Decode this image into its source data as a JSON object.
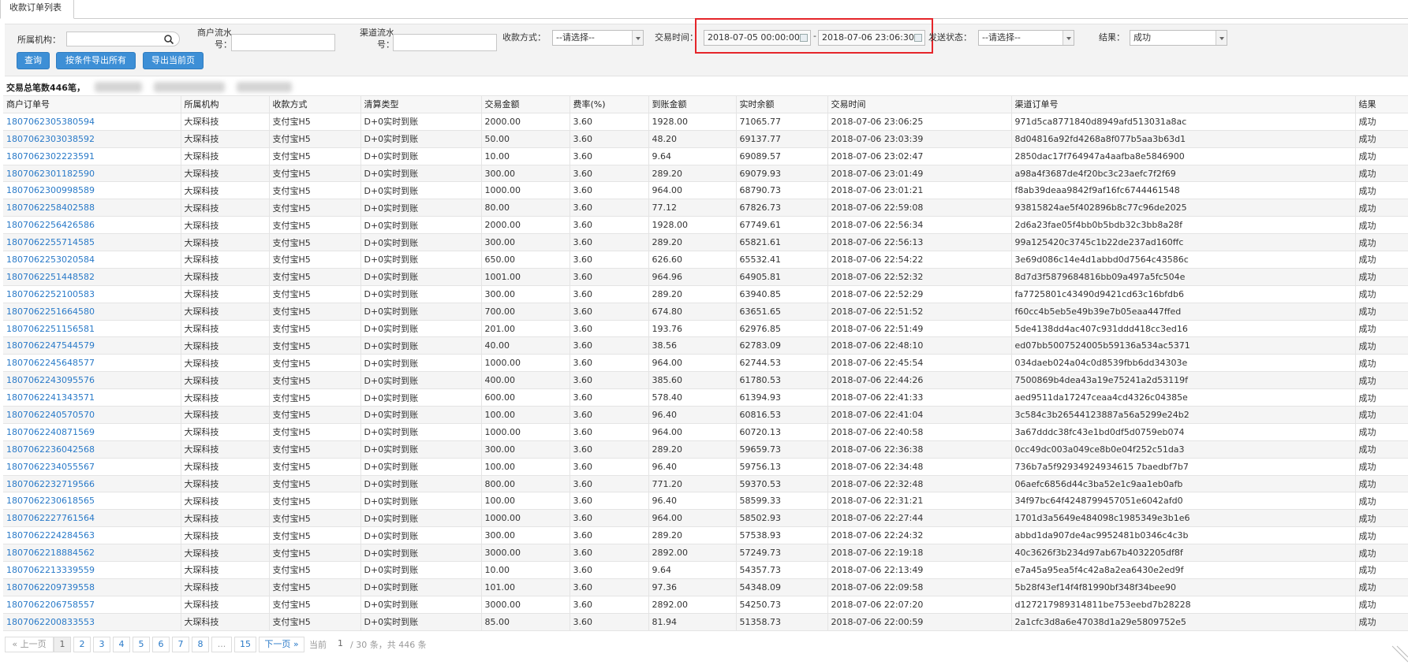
{
  "tab": {
    "label": "收款订单列表"
  },
  "filters": {
    "org_label": "所属机构：",
    "org_value": "",
    "merchant_serial_label": "商户流水号：",
    "merchant_serial_value": "",
    "channel_serial_label": "渠道流水号：",
    "channel_serial_value": "",
    "pay_method_label": "收款方式：",
    "pay_method_value": "--请选择--",
    "trade_time_label": "交易时间：",
    "trade_time_start": "2018-07-05 00:00:00",
    "trade_time_sep": "-",
    "trade_time_end": "2018-07-06 23:06:30",
    "send_status_label": "发送状态：",
    "send_status_value": "--请选择--",
    "result_label": "结果：",
    "result_value": "成功"
  },
  "buttons": {
    "query": "查询",
    "export_all": "按条件导出所有",
    "export_page": "导出当前页"
  },
  "summary": {
    "text": "交易总笔数446笔，"
  },
  "table": {
    "columns": [
      "商户订单号",
      "所属机构",
      "收款方式",
      "清算类型",
      "交易金额",
      "费率(%)",
      "到账金额",
      "实时余额",
      "交易时间",
      "渠道订单号",
      "结果"
    ],
    "rows": [
      [
        "1807062305380594",
        "大琛科技",
        "支付宝H5",
        "D+0实时到账",
        "2000.00",
        "3.60",
        "1928.00",
        "71065.77",
        "2018-07-06 23:06:25",
        "971d5ca8771840d8949afd513031a8ac",
        "成功"
      ],
      [
        "1807062303038592",
        "大琛科技",
        "支付宝H5",
        "D+0实时到账",
        "50.00",
        "3.60",
        "48.20",
        "69137.77",
        "2018-07-06 23:03:39",
        "8d04816a92fd4268a8f077b5aa3b63d1",
        "成功"
      ],
      [
        "1807062302223591",
        "大琛科技",
        "支付宝H5",
        "D+0实时到账",
        "10.00",
        "3.60",
        "9.64",
        "69089.57",
        "2018-07-06 23:02:47",
        "2850dac17f764947a4aafba8e5846900",
        "成功"
      ],
      [
        "1807062301182590",
        "大琛科技",
        "支付宝H5",
        "D+0实时到账",
        "300.00",
        "3.60",
        "289.20",
        "69079.93",
        "2018-07-06 23:01:49",
        "a98a4f3687de4f20bc3c23aefc7f2f69",
        "成功"
      ],
      [
        "1807062300998589",
        "大琛科技",
        "支付宝H5",
        "D+0实时到账",
        "1000.00",
        "3.60",
        "964.00",
        "68790.73",
        "2018-07-06 23:01:21",
        "f8ab39deaa9842f9af16fc6744461548",
        "成功"
      ],
      [
        "1807062258402588",
        "大琛科技",
        "支付宝H5",
        "D+0实时到账",
        "80.00",
        "3.60",
        "77.12",
        "67826.73",
        "2018-07-06 22:59:08",
        "93815824ae5f402896b8c77c96de2025",
        "成功"
      ],
      [
        "1807062256426586",
        "大琛科技",
        "支付宝H5",
        "D+0实时到账",
        "2000.00",
        "3.60",
        "1928.00",
        "67749.61",
        "2018-07-06 22:56:34",
        "2d6a23fae05f4bb0b5bdb32c3bb8a28f",
        "成功"
      ],
      [
        "1807062255714585",
        "大琛科技",
        "支付宝H5",
        "D+0实时到账",
        "300.00",
        "3.60",
        "289.20",
        "65821.61",
        "2018-07-06 22:56:13",
        "99a125420c3745c1b22de237ad160ffc",
        "成功"
      ],
      [
        "1807062253020584",
        "大琛科技",
        "支付宝H5",
        "D+0实时到账",
        "650.00",
        "3.60",
        "626.60",
        "65532.41",
        "2018-07-06 22:54:22",
        "3e69d086c14e4d1abbd0d7564c43586c",
        "成功"
      ],
      [
        "1807062251448582",
        "大琛科技",
        "支付宝H5",
        "D+0实时到账",
        "1001.00",
        "3.60",
        "964.96",
        "64905.81",
        "2018-07-06 22:52:32",
        "8d7d3f5879684816bb09a497a5fc504e",
        "成功"
      ],
      [
        "1807062252100583",
        "大琛科技",
        "支付宝H5",
        "D+0实时到账",
        "300.00",
        "3.60",
        "289.20",
        "63940.85",
        "2018-07-06 22:52:29",
        "fa7725801c43490d9421cd63c16bfdb6",
        "成功"
      ],
      [
        "1807062251664580",
        "大琛科技",
        "支付宝H5",
        "D+0实时到账",
        "700.00",
        "3.60",
        "674.80",
        "63651.65",
        "2018-07-06 22:51:52",
        "f60cc4b5eb5e49b39e7b05eaa447ffed",
        "成功"
      ],
      [
        "1807062251156581",
        "大琛科技",
        "支付宝H5",
        "D+0实时到账",
        "201.00",
        "3.60",
        "193.76",
        "62976.85",
        "2018-07-06 22:51:49",
        "5de4138dd4ac407c931ddd418cc3ed16",
        "成功"
      ],
      [
        "1807062247544579",
        "大琛科技",
        "支付宝H5",
        "D+0实时到账",
        "40.00",
        "3.60",
        "38.56",
        "62783.09",
        "2018-07-06 22:48:10",
        "ed07bb5007524005b59136a534ac5371",
        "成功"
      ],
      [
        "1807062245648577",
        "大琛科技",
        "支付宝H5",
        "D+0实时到账",
        "1000.00",
        "3.60",
        "964.00",
        "62744.53",
        "2018-07-06 22:45:54",
        "034daeb024a04c0d8539fbb6dd34303e",
        "成功"
      ],
      [
        "1807062243095576",
        "大琛科技",
        "支付宝H5",
        "D+0实时到账",
        "400.00",
        "3.60",
        "385.60",
        "61780.53",
        "2018-07-06 22:44:26",
        "7500869b4dea43a19e75241a2d53119f",
        "成功"
      ],
      [
        "1807062241343571",
        "大琛科技",
        "支付宝H5",
        "D+0实时到账",
        "600.00",
        "3.60",
        "578.40",
        "61394.93",
        "2018-07-06 22:41:33",
        "aed9511da17247ceaa4cd4326c04385e",
        "成功"
      ],
      [
        "1807062240570570",
        "大琛科技",
        "支付宝H5",
        "D+0实时到账",
        "100.00",
        "3.60",
        "96.40",
        "60816.53",
        "2018-07-06 22:41:04",
        "3c584c3b26544123887a56a5299e24b2",
        "成功"
      ],
      [
        "1807062240871569",
        "大琛科技",
        "支付宝H5",
        "D+0实时到账",
        "1000.00",
        "3.60",
        "964.00",
        "60720.13",
        "2018-07-06 22:40:58",
        "3a67dddc38fc43e1bd0df5d0759eb074",
        "成功"
      ],
      [
        "1807062236042568",
        "大琛科技",
        "支付宝H5",
        "D+0实时到账",
        "300.00",
        "3.60",
        "289.20",
        "59659.73",
        "2018-07-06 22:36:38",
        "0cc49dc003a049ce8b0e04f252c51da3",
        "成功"
      ],
      [
        "1807062234055567",
        "大琛科技",
        "支付宝H5",
        "D+0实时到账",
        "100.00",
        "3.60",
        "96.40",
        "59756.13",
        "2018-07-06 22:34:48",
        "736b7a5f92934924934615 7baedbf7b7",
        "成功"
      ],
      [
        "1807062232719566",
        "大琛科技",
        "支付宝H5",
        "D+0实时到账",
        "800.00",
        "3.60",
        "771.20",
        "59370.53",
        "2018-07-06 22:32:48",
        "06aefc6856d44c3ba52e1c9aa1eb0afb",
        "成功"
      ],
      [
        "1807062230618565",
        "大琛科技",
        "支付宝H5",
        "D+0实时到账",
        "100.00",
        "3.60",
        "96.40",
        "58599.33",
        "2018-07-06 22:31:21",
        "34f97bc64f4248799457051e6042afd0",
        "成功"
      ],
      [
        "1807062227761564",
        "大琛科技",
        "支付宝H5",
        "D+0实时到账",
        "1000.00",
        "3.60",
        "964.00",
        "58502.93",
        "2018-07-06 22:27:44",
        "1701d3a5649e484098c1985349e3b1e6",
        "成功"
      ],
      [
        "1807062224284563",
        "大琛科技",
        "支付宝H5",
        "D+0实时到账",
        "300.00",
        "3.60",
        "289.20",
        "57538.93",
        "2018-07-06 22:24:32",
        "abbd1da907de4ac9952481b0346c4c3b",
        "成功"
      ],
      [
        "1807062218884562",
        "大琛科技",
        "支付宝H5",
        "D+0实时到账",
        "3000.00",
        "3.60",
        "2892.00",
        "57249.73",
        "2018-07-06 22:19:18",
        "40c3626f3b234d97ab67b4032205df8f",
        "成功"
      ],
      [
        "1807062213339559",
        "大琛科技",
        "支付宝H5",
        "D+0实时到账",
        "10.00",
        "3.60",
        "9.64",
        "54357.73",
        "2018-07-06 22:13:49",
        "e7a45a95ea5f4c42a8a2ea6430e2ed9f",
        "成功"
      ],
      [
        "1807062209739558",
        "大琛科技",
        "支付宝H5",
        "D+0实时到账",
        "101.00",
        "3.60",
        "97.36",
        "54348.09",
        "2018-07-06 22:09:58",
        "5b28f43ef14f4f81990bf348f34bee90",
        "成功"
      ],
      [
        "1807062206758557",
        "大琛科技",
        "支付宝H5",
        "D+0实时到账",
        "3000.00",
        "3.60",
        "2892.00",
        "54250.73",
        "2018-07-06 22:07:20",
        "d127217989314811be753eebd7b28228",
        "成功"
      ],
      [
        "1807062200833553",
        "大琛科技",
        "支付宝H5",
        "D+0实时到账",
        "85.00",
        "3.60",
        "81.94",
        "51358.73",
        "2018-07-06 22:00:59",
        "2a1cfc3d8a6e47038d1a29e5809752e5",
        "成功"
      ]
    ]
  },
  "pager": {
    "prev": "« 上一页",
    "pages": [
      "1",
      "2",
      "3",
      "4",
      "5",
      "6",
      "7",
      "8",
      "...",
      "15"
    ],
    "next": "下一页 »",
    "current_label": "当前",
    "current_page": "1",
    "info": "/ 30 条，共 446 条"
  },
  "colors": {
    "link": "#2a7ac8",
    "button": "#3d8fd6",
    "highlight": "#e5252a"
  }
}
